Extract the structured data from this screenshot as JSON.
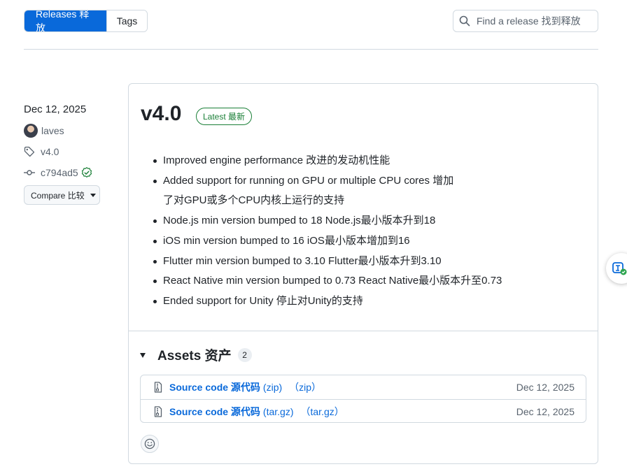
{
  "tabs": {
    "releases_label": "Releases 释放",
    "tags_label": "Tags"
  },
  "search": {
    "placeholder": "Find a release 找到释放"
  },
  "meta": {
    "date": "Dec 12, 2025",
    "author": "laves",
    "tag": "v4.0",
    "commit": "c794ad5",
    "compare_label": "Compare 比较"
  },
  "release": {
    "title": "v4.0",
    "badge": "Latest 最新",
    "notes": [
      "Improved engine performance 改进的发动机性能",
      "Added support for running on GPU or multiple CPU cores 增加了对GPU或多个CPU内核上运行的支持",
      "Node.js min version bumped to 18 Node.js最小版本升到18",
      "iOS min version bumped to 16 iOS最小版本增加到16",
      "Flutter min version bumped to 3.10 Flutter最小版本升到3.10",
      "React Native min version bumped to 0.73 React Native最小版本升至0.73",
      "Ended support for Unity 停止对Unity的支持"
    ]
  },
  "assets": {
    "title": "Assets 资产",
    "count": "2",
    "items": [
      {
        "name": "Source code 源代码",
        "ext": "(zip)",
        "ext2": "（zip）",
        "date": "Dec 12, 2025"
      },
      {
        "name": "Source code 源代码",
        "ext": "(tar.gz)",
        "ext2": "（tar.gz）",
        "date": "Dec 12, 2025"
      }
    ]
  },
  "icons": {
    "search": "search-icon",
    "tag": "tag-icon",
    "commit": "git-commit-icon",
    "verified": "verified-icon",
    "zip": "file-zip-icon",
    "smiley": "smiley-icon",
    "translate": "translate-icon"
  },
  "colors": {
    "accent": "#0969da",
    "success": "#1a7f37",
    "border": "#d1d9e0",
    "text": "#1f2328",
    "muted": "#59636e"
  }
}
